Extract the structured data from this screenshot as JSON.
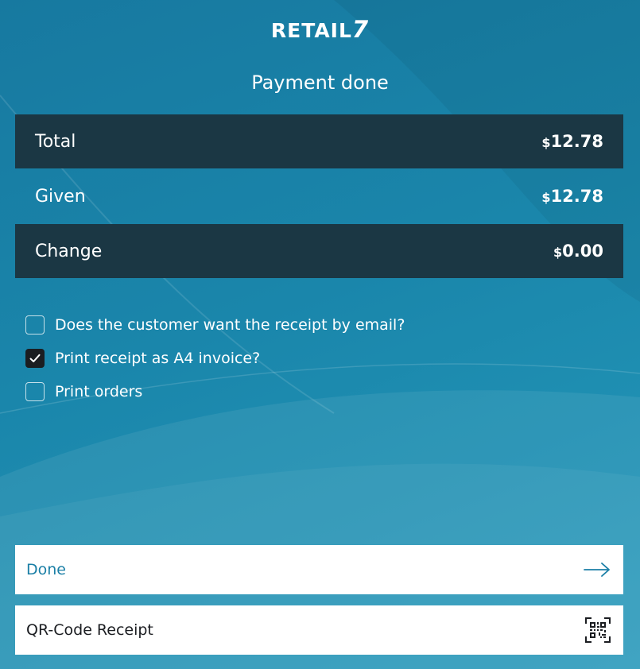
{
  "brand": {
    "logo_text": "RETAIL",
    "logo_mark": "7"
  },
  "title": "Payment done",
  "summary": {
    "total": {
      "label": "Total",
      "currency": "$",
      "amount": "12.78"
    },
    "given": {
      "label": "Given",
      "currency": "$",
      "amount": "12.78"
    },
    "change": {
      "label": "Change",
      "currency": "$",
      "amount": "0.00"
    }
  },
  "options": [
    {
      "label": "Does the customer want the receipt by email?",
      "checked": false
    },
    {
      "label": "Print receipt as A4 invoice?",
      "checked": true
    },
    {
      "label": "Print orders",
      "checked": false
    }
  ],
  "actions": {
    "done_label": "Done",
    "done_icon": "arrow-right-icon",
    "qr_label": "QR-Code Receipt",
    "qr_icon": "qr-code-icon"
  },
  "colors": {
    "background": "#1a86ab",
    "dark_row": "#1b3744",
    "accent_text": "#1b7fa6",
    "checkbox_checked": "#1b1d21"
  }
}
